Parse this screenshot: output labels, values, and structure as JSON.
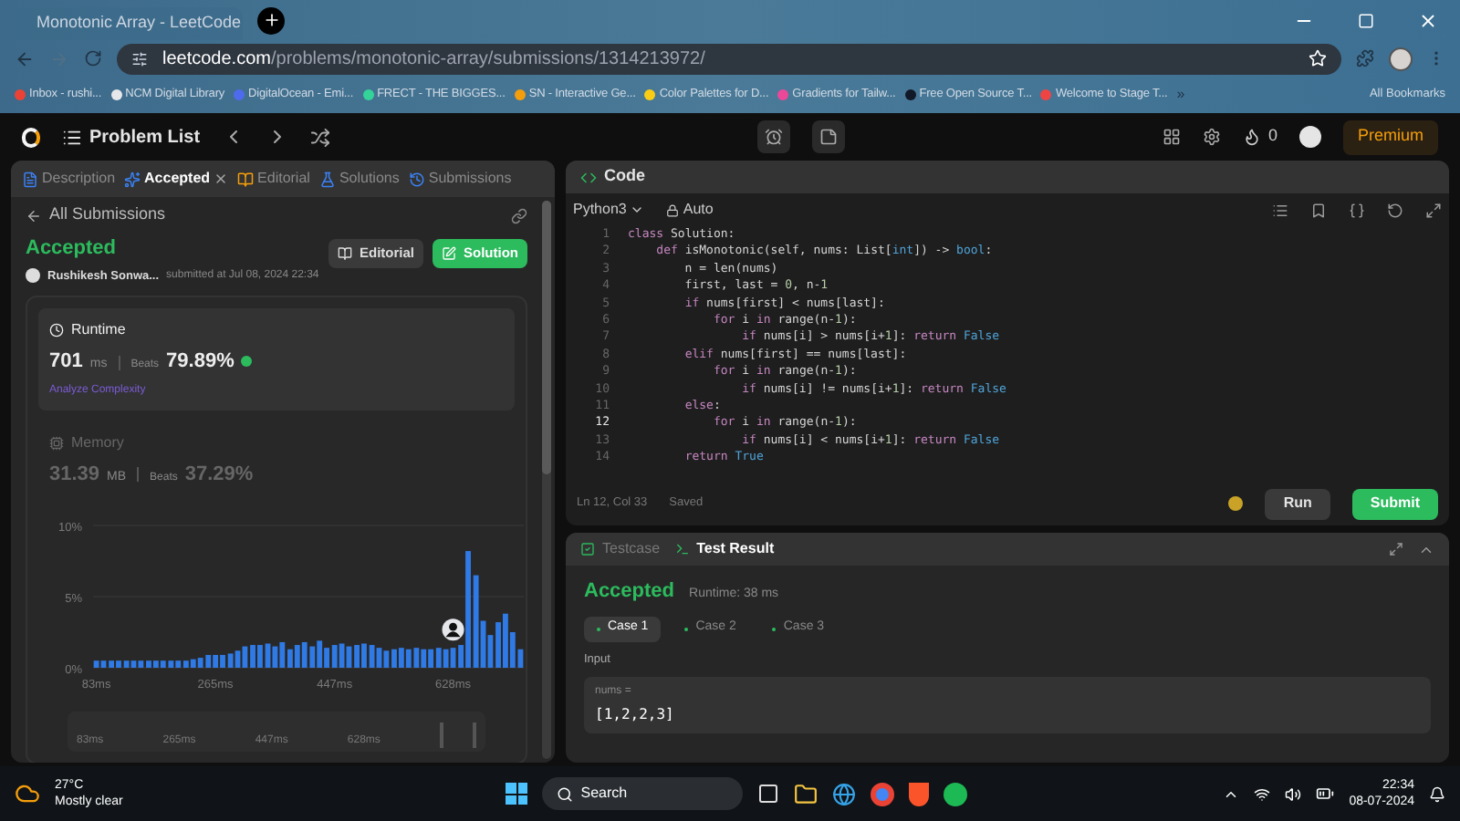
{
  "browser": {
    "tab_title": "Monotonic Array - LeetCode",
    "address_domain": "leetcode.com",
    "address_path": "/problems/monotonic-array/submissions/1314213972/",
    "bookmarks": [
      {
        "label": "Inbox - rushi...",
        "color": "#ea4335"
      },
      {
        "label": "NCM Digital Library",
        "color": "#e5e7eb"
      },
      {
        "label": "DigitalOcean - Emi...",
        "color": "#4f6bed"
      },
      {
        "label": "FRECT - THE BIGGES...",
        "color": "#34d399"
      },
      {
        "label": "SN - Interactive Ge...",
        "color": "#f59e0b"
      },
      {
        "label": "Color Palettes for D...",
        "color": "#facc15"
      },
      {
        "label": "Gradients for Tailw...",
        "color": "#ec4899"
      },
      {
        "label": "Free Open Source T...",
        "color": "#111827"
      },
      {
        "label": "Welcome to Stage T...",
        "color": "#ef4444"
      }
    ],
    "more_bookmarks": "»",
    "all_bookmarks": "All Bookmarks"
  },
  "nav": {
    "title": "Problem List",
    "streak": "0",
    "premium": "Premium"
  },
  "left": {
    "tabs": [
      {
        "label": "Description",
        "selected": false
      },
      {
        "label": "Accepted",
        "selected": true
      },
      {
        "label": "Editorial",
        "selected": false
      },
      {
        "label": "Solutions",
        "selected": false
      },
      {
        "label": "Submissions",
        "selected": false
      }
    ],
    "back": "All Submissions",
    "status": "Accepted",
    "author": "Rushikesh Sonwa...",
    "submitted": "submitted at Jul 08, 2024 22:34",
    "editorial_button": "Editorial",
    "solution_button": "Solution",
    "metrics": [
      {
        "kind": "runtime",
        "title": "Runtime",
        "value": "701",
        "unit": "ms",
        "beats_label": "Beats",
        "beats": "79.89%",
        "link": "Analyze Complexity",
        "selected": true
      },
      {
        "kind": "memory",
        "title": "Memory",
        "value": "31.39",
        "unit": "MB",
        "beats_label": "Beats",
        "beats": "37.29%",
        "selected": false
      }
    ],
    "chart_data": {
      "type": "bar",
      "ylim": [
        0,
        10
      ],
      "yticks": [
        {
          "value": 0,
          "label": "0%"
        },
        {
          "value": 5,
          "label": "5%"
        },
        {
          "value": 10,
          "label": "10%"
        }
      ],
      "xlim": [
        78,
        736
      ],
      "xticks": [
        {
          "value": 83,
          "label": "83ms"
        },
        {
          "value": 265,
          "label": "265ms"
        },
        {
          "value": 447,
          "label": "447ms"
        },
        {
          "value": 628,
          "label": "628ms"
        }
      ],
      "x": [
        83,
        94,
        106,
        117,
        129,
        140,
        151,
        163,
        174,
        185,
        197,
        208,
        220,
        231,
        242,
        254,
        265,
        276,
        288,
        299,
        310,
        322,
        333,
        345,
        356,
        367,
        379,
        390,
        401,
        413,
        424,
        435,
        447,
        458,
        469,
        481,
        492,
        504,
        515,
        526,
        538,
        549,
        560,
        572,
        583,
        594,
        606,
        617,
        628,
        640,
        651,
        663,
        674,
        685,
        697,
        708,
        719,
        731
      ],
      "values": [
        0.5,
        0.5,
        0.5,
        0.5,
        0.5,
        0.5,
        0.5,
        0.5,
        0.5,
        0.5,
        0.5,
        0.5,
        0.5,
        0.6,
        0.7,
        0.9,
        0.9,
        0.9,
        1.0,
        1.2,
        1.5,
        1.6,
        1.6,
        1.7,
        1.5,
        1.8,
        1.3,
        1.6,
        1.8,
        1.5,
        1.9,
        1.4,
        1.6,
        1.7,
        1.5,
        1.6,
        1.7,
        1.6,
        1.4,
        1.2,
        1.3,
        1.4,
        1.3,
        1.4,
        1.3,
        1.3,
        1.4,
        1.3,
        1.4,
        1.6,
        8.2,
        6.5,
        3.3,
        2.3,
        3.2,
        3.8,
        2.5,
        1.3
      ]
    },
    "minimap_labels": [
      "83ms",
      "265ms",
      "447ms",
      "628ms"
    ]
  },
  "code": {
    "header": "Code",
    "language": "Python3",
    "mode": "Auto",
    "lines": [
      {
        "number": "1",
        "text": "class Solution:",
        "active": false
      },
      {
        "number": "2",
        "text": "    def isMonotonic(self, nums: List[int]) -> bool:",
        "active": false
      },
      {
        "number": "3",
        "text": "        n = len(nums)",
        "active": false
      },
      {
        "number": "4",
        "text": "        first, last = 0, n-1",
        "active": false
      },
      {
        "number": "5",
        "text": "        if nums[first] < nums[last]:",
        "active": false
      },
      {
        "number": "6",
        "text": "            for i in range(n-1):",
        "active": false
      },
      {
        "number": "7",
        "text": "                if nums[i] > nums[i+1]: return False",
        "active": false
      },
      {
        "number": "8",
        "text": "        elif nums[first] == nums[last]:",
        "active": false
      },
      {
        "number": "9",
        "text": "            for i in range(n-1):",
        "active": false
      },
      {
        "number": "10",
        "text": "                if nums[i] != nums[i+1]: return False",
        "active": false
      },
      {
        "number": "11",
        "text": "        else:",
        "active": false
      },
      {
        "number": "12",
        "text": "            for i in range(n-1):",
        "active": true
      },
      {
        "number": "13",
        "text": "                if nums[i] < nums[i+1]: return False",
        "active": false
      },
      {
        "number": "14",
        "text": "        return True",
        "active": false
      }
    ],
    "position": "Ln 12, Col 33",
    "saved": "Saved",
    "run": "Run",
    "submit": "Submit"
  },
  "result": {
    "tabs": [
      {
        "label": "Testcase",
        "selected": false
      },
      {
        "label": "Test Result",
        "selected": true
      }
    ],
    "status": "Accepted",
    "runtime": "Runtime: 38 ms",
    "cases": [
      {
        "label": "Case 1",
        "selected": true
      },
      {
        "label": "Case 2",
        "selected": false
      },
      {
        "label": "Case 3",
        "selected": false
      }
    ],
    "input_label": "Input",
    "param": "nums =",
    "value": "[1,2,2,3]"
  },
  "taskbar": {
    "temperature": "27°C",
    "weather": "Mostly clear",
    "search": "Search",
    "time": "22:34",
    "date": "08-07-2024"
  }
}
